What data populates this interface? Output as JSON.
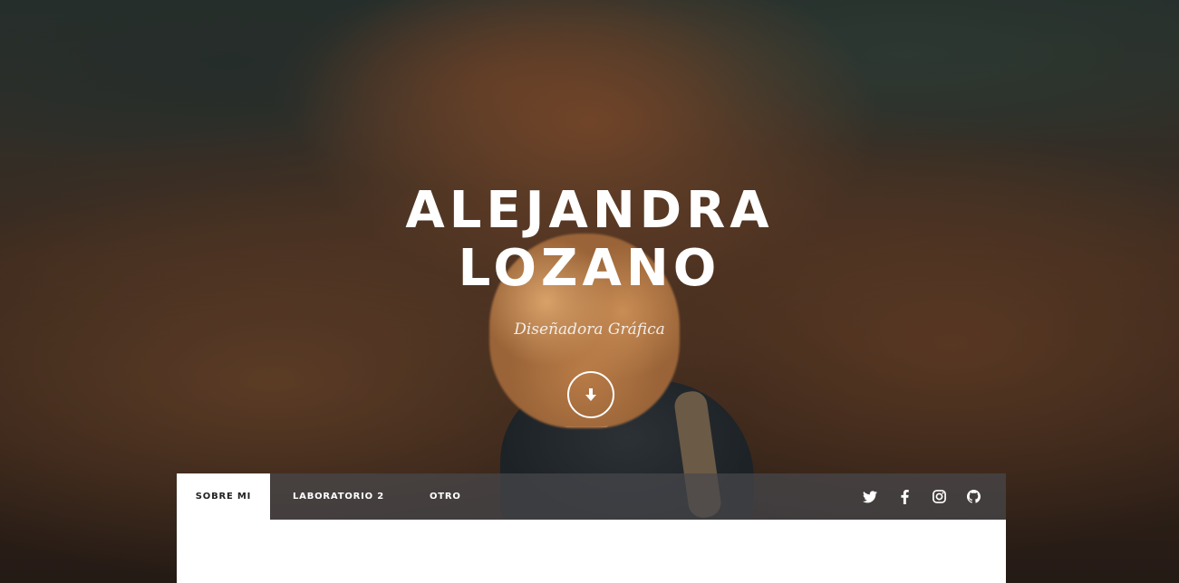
{
  "hero": {
    "name_line1": "ALEJANDRA",
    "name_line2": "LOZANO",
    "subtitle": "Diseñadora Gráfica",
    "scroll_icon": "arrow-down-icon"
  },
  "nav": {
    "tabs": [
      {
        "label": "SOBRE MI",
        "active": true
      },
      {
        "label": "LABORATORIO 2",
        "active": false
      },
      {
        "label": "OTRO",
        "active": false
      }
    ],
    "social": [
      "twitter-icon",
      "facebook-icon",
      "instagram-icon",
      "github-icon"
    ]
  },
  "colors": {
    "nav_background": "#48484c",
    "active_tab": "#ffffff",
    "text": "#ffffff"
  }
}
